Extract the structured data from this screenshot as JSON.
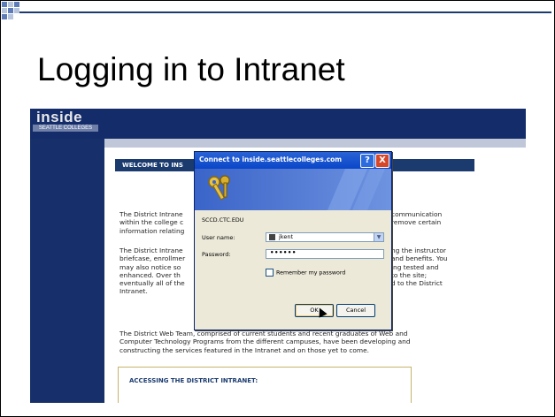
{
  "slide": {
    "title": "Logging in to Intranet"
  },
  "site": {
    "logo_text": "inside",
    "logo_sub": "SEATTLE COLLEGES",
    "welcome_heading": "WELCOME TO INS",
    "para1": [
      "The District Intrane",
      "within the college c",
      "information relating"
    ],
    "para1_right": [
      "communication",
      "remove certain",
      ""
    ],
    "para2": [
      "The District Intrane",
      "briefcase, enrollmer",
      "may also notice so",
      "enhanced. Over th",
      "eventually all of the",
      "Intranet."
    ],
    "para2_right": [
      "ng the instructor",
      "and benefits. You",
      "ing tested and",
      "to the site;",
      "d to the District",
      ""
    ],
    "para3": [
      "The District Web Team, comprised of current students and recent graduates of Web and",
      "Computer Technology Programs from the different campuses, have been developing and",
      "constructing the services featured in the Intranet and on those yet to come."
    ],
    "access_heading": "ACCESSING THE DISTRICT INTRANET:"
  },
  "dialog": {
    "title": "Connect to inside.seattlecolleges.com",
    "help_glyph": "?",
    "close_glyph": "X",
    "server": "SCCD.CTC.EDU",
    "username_label": "User name:",
    "username_value": "jkent",
    "password_label": "Password:",
    "password_value": "••••••",
    "remember_label": "Remember my password",
    "ok_label": "OK",
    "cancel_label": "Cancel"
  },
  "icons": {
    "keys": "keys-icon",
    "user": "user-icon",
    "dropdown": "chevron-down-icon"
  },
  "colors": {
    "site_navy": "#142c6a",
    "dialog_title": "#0a46c8",
    "dialog_body": "#ece9d8",
    "close_red": "#d6472a"
  }
}
